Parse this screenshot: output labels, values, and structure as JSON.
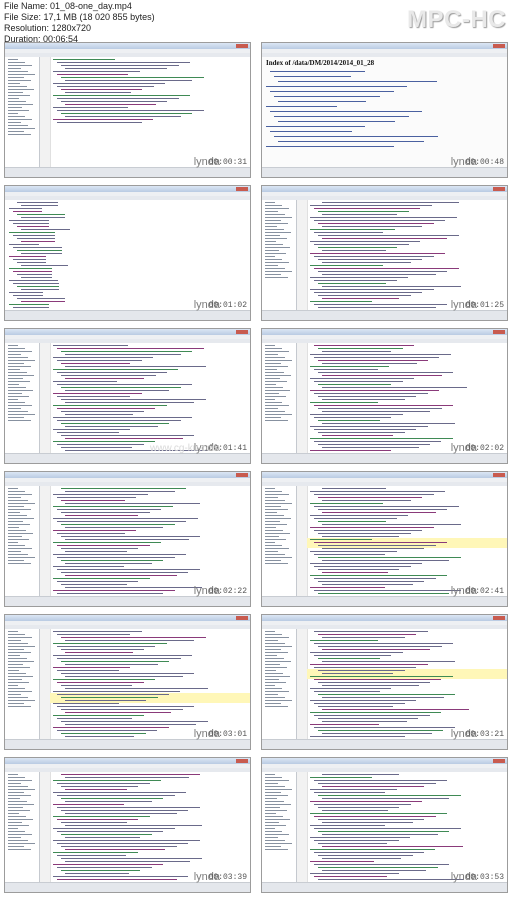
{
  "media_info": {
    "file_name": "File Name: 01_08-one_day.mp4",
    "file_size": "File Size: 17,1 MB (18 020 855 bytes)",
    "resolution": "Resolution: 1280x720",
    "duration": "Duration: 00:06:54"
  },
  "player_logo": "MPC-HC",
  "watermark": "www.cg-ku.com",
  "brand": "lynda",
  "frames": [
    {
      "timestamp": "00:00:31",
      "kind": "db"
    },
    {
      "timestamp": "00:00:48",
      "kind": "browser",
      "page_title": "Index of /data/DM/2014/2014_01_28"
    },
    {
      "timestamp": "00:01:02",
      "kind": "terminal"
    },
    {
      "timestamp": "00:01:25",
      "kind": "ide"
    },
    {
      "timestamp": "00:01:41",
      "kind": "ide"
    },
    {
      "timestamp": "00:02:02",
      "kind": "ide"
    },
    {
      "timestamp": "00:02:22",
      "kind": "ide"
    },
    {
      "timestamp": "00:02:41",
      "kind": "ide"
    },
    {
      "timestamp": "00:03:01",
      "kind": "ide"
    },
    {
      "timestamp": "00:03:21",
      "kind": "ide"
    },
    {
      "timestamp": "00:03:39",
      "kind": "ide"
    },
    {
      "timestamp": "00:03:53",
      "kind": "ide"
    }
  ]
}
